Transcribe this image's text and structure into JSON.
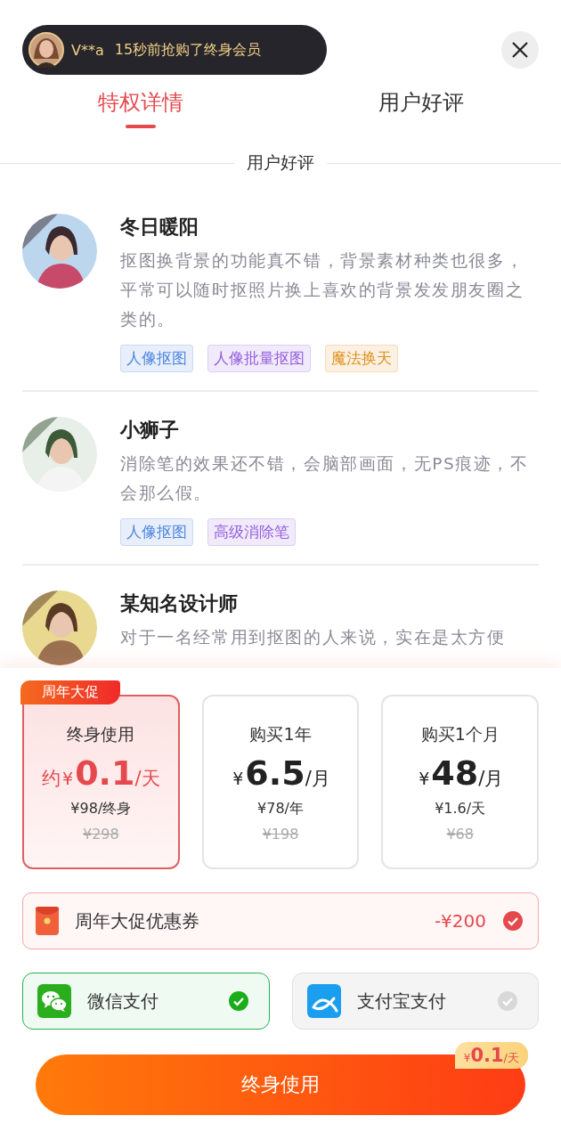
{
  "toast": {
    "user": "V**a",
    "message": "15秒前抢购了终身会员"
  },
  "tabs": [
    {
      "label": "特权详情",
      "selected": true
    },
    {
      "label": "用户好评",
      "selected": false
    }
  ],
  "section_title": "用户好评",
  "reviews": [
    {
      "name": "冬日暖阳",
      "text": "抠图换背景的功能真不错，背景素材种类也很多，平常可以随时抠照片换上喜欢的背景发发朋友圈之类的。",
      "tags": [
        {
          "label": "人像抠图",
          "color": "#4f86e0"
        },
        {
          "label": "人像批量抠图",
          "color": "#9460de"
        },
        {
          "label": "魔法换天",
          "color": "#e0901e"
        }
      ]
    },
    {
      "name": "小狮子",
      "text": "消除笔的效果还不错，会脑部画面，无PS痕迹，不会那么假。",
      "tags": [
        {
          "label": "人像抠图",
          "color": "#4f86e0"
        },
        {
          "label": "高级消除笔",
          "color": "#9460de"
        }
      ]
    },
    {
      "name": "某知名设计师",
      "text": "对于一名经常用到抠图的人来说，实在是太方便"
    }
  ],
  "plans": [
    {
      "badge": "周年大促",
      "title": "终身使用",
      "prefix": "约",
      "currency": "¥",
      "price": "0.1",
      "unit": "/天",
      "subprice": "¥98/终身",
      "original": "¥298",
      "selected": true
    },
    {
      "title": "购买1年",
      "currency": "¥",
      "price": "6.5",
      "unit": "/月",
      "subprice": "¥78/年",
      "original": "¥198",
      "selected": false
    },
    {
      "title": "购买1个月",
      "currency": "¥",
      "price": "48",
      "unit": "/月",
      "subprice": "¥1.6/天",
      "original": "¥68",
      "selected": false
    }
  ],
  "coupon": {
    "label": "周年大促优惠券",
    "amount": "-¥200",
    "checked": true
  },
  "payments": [
    {
      "kind": "wechat",
      "label": "微信支付",
      "selected": true
    },
    {
      "kind": "alipay",
      "label": "支付宝支付",
      "selected": false
    }
  ],
  "buy_button": {
    "label": "终身使用",
    "badge_currency": "¥",
    "badge_price": "0.1",
    "badge_unit": "/天"
  }
}
